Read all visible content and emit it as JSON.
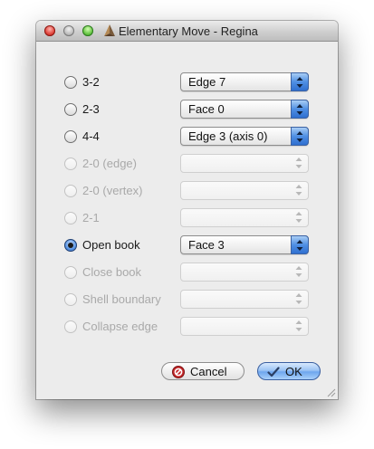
{
  "window": {
    "title": "Elementary Move - Regina"
  },
  "moves": [
    {
      "label": "3-2",
      "enabled": true,
      "checked": false,
      "selection": "Edge 7"
    },
    {
      "label": "2-3",
      "enabled": true,
      "checked": false,
      "selection": "Face 0"
    },
    {
      "label": "4-4",
      "enabled": true,
      "checked": false,
      "selection": "Edge 3 (axis 0)"
    },
    {
      "label": "2-0 (edge)",
      "enabled": false,
      "checked": false,
      "selection": ""
    },
    {
      "label": "2-0 (vertex)",
      "enabled": false,
      "checked": false,
      "selection": ""
    },
    {
      "label": "2-1",
      "enabled": false,
      "checked": false,
      "selection": ""
    },
    {
      "label": "Open book",
      "enabled": true,
      "checked": true,
      "selection": "Face 3"
    },
    {
      "label": "Close book",
      "enabled": false,
      "checked": false,
      "selection": ""
    },
    {
      "label": "Shell boundary",
      "enabled": false,
      "checked": false,
      "selection": ""
    },
    {
      "label": "Collapse edge",
      "enabled": false,
      "checked": false,
      "selection": ""
    }
  ],
  "buttons": {
    "cancel_label": "Cancel",
    "ok_label": "OK"
  },
  "icons": {
    "close": "close-icon",
    "cancel": "stop-icon",
    "ok": "checkmark-icon",
    "app": "regina-app-icon"
  },
  "colors": {
    "accent": "#4f8fe3",
    "window_bg": "#ececec",
    "disabled_text": "#a9a9a9"
  }
}
